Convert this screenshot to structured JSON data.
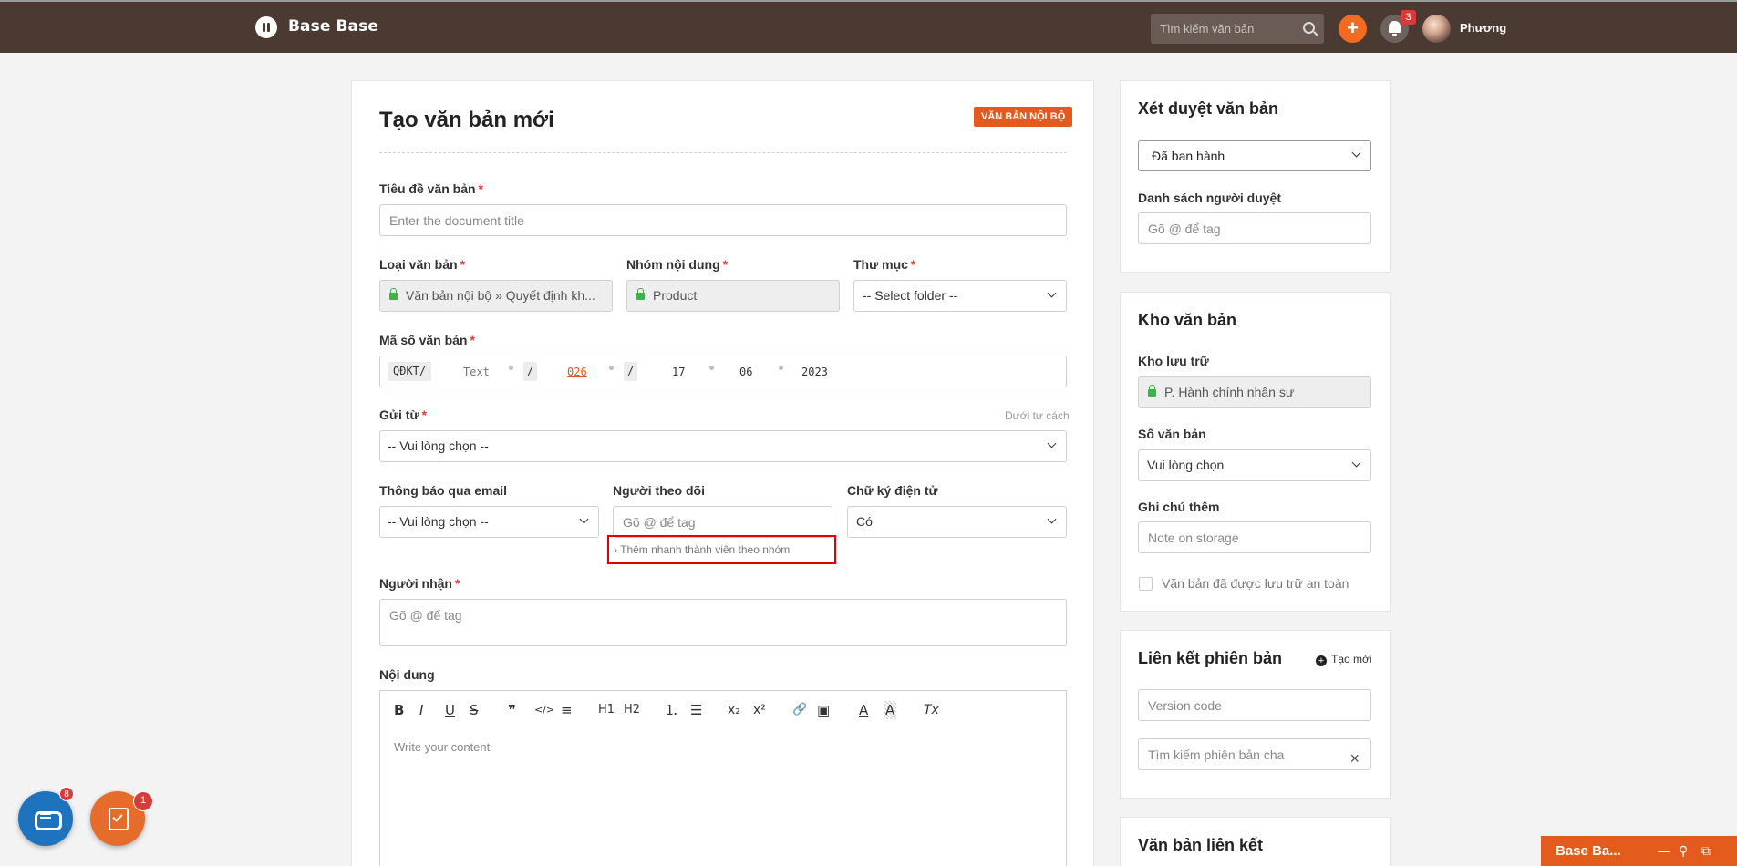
{
  "topbar": {
    "brand": "Base Base",
    "search_placeholder": "Tìm kiếm văn bản",
    "notif_count": "3",
    "user_name": "Phương"
  },
  "form": {
    "title": "Tạo văn bản mới",
    "tag": "VĂN BẢN NỘI BỘ",
    "doc_title_label": "Tiêu đề văn bản",
    "doc_title_placeholder": "Enter the document title",
    "type_label": "Loại văn bản",
    "type_value": "Văn bản nội bộ  »  Quyết định kh...",
    "group_label": "Nhóm nội dung",
    "group_value": "Product",
    "folder_label": "Thư mục",
    "folder_value": "-- Select folder --",
    "code_label": "Mã số văn bản",
    "code": {
      "prefix": "QĐKT/",
      "text": "Text",
      "slash1": "/",
      "num": "026",
      "slash2": "/",
      "day": "17",
      "month": "06",
      "year": "2023"
    },
    "from_label": "Gửi từ",
    "from_hint": "Dưới tư cách",
    "from_value": "-- Vui lòng chọn --",
    "email_label": "Thông báo qua email",
    "email_value": "-- Vui lòng chọn --",
    "follower_label": "Người theo dõi",
    "follower_placeholder": "Gõ @ để tag",
    "quick_add": "› Thêm nhanh thành viên theo nhóm",
    "sign_label": "Chữ ký điện tử",
    "sign_value": "Có",
    "recipient_label": "Người nhận",
    "recipient_placeholder": "Gõ @ để tag",
    "content_label": "Nội dung",
    "content_placeholder": "Write your content",
    "required_mark": "*"
  },
  "toolbar": {
    "bold": "B",
    "italic": "I",
    "underline": "U",
    "strike": "S",
    "quote": "❞",
    "code": "</>",
    "align": "≡",
    "h1": "H1",
    "h2": "H2",
    "ol": "⒈",
    "ul": "☰",
    "sub": "x₂",
    "sup": "x²",
    "link": "🔗",
    "image": "▣",
    "color": "A",
    "bg": "A",
    "clear": "Tx"
  },
  "review": {
    "title": "Xét duyệt văn bản",
    "status_value": "Đã ban hành",
    "approvers_label": "Danh sách người duyệt",
    "approvers_placeholder": "Gõ @ để tag"
  },
  "storage": {
    "title": "Kho văn bản",
    "archive_label": "Kho lưu trữ",
    "archive_value": "P. Hành chính nhân sư",
    "book_label": "Sổ văn bản",
    "book_value": "Vui lòng chọn",
    "note_label": "Ghi chú thêm",
    "note_placeholder": "Note on storage",
    "safe_label": "Văn bản đã được lưu trữ an toàn"
  },
  "version": {
    "title": "Liên kết phiên bản",
    "new_label": "Tạo mới",
    "code_placeholder": "Version code",
    "parent_placeholder": "Tìm kiếm phiên bản cha",
    "clear": "×"
  },
  "linked": {
    "title": "Văn bản liên kết"
  },
  "widgets": {
    "chat_badge": "8",
    "task_badge": "1",
    "mini_title": "Base Ba...",
    "mini_min": "—",
    "mini_search": "⚲",
    "mini_open": "⧉"
  },
  "colors": {
    "topbar": "#4b3a32",
    "accent": "#f26b21",
    "tag": "#e55a1c",
    "highlight": "#e00000"
  }
}
